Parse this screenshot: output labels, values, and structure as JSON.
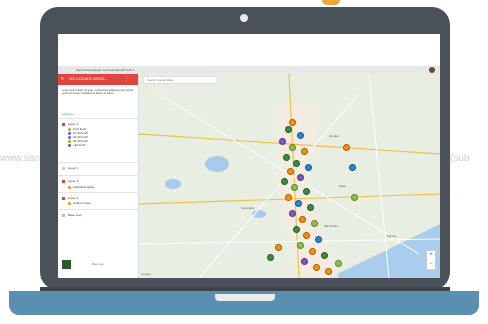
{
  "browser": {
    "url": "https://www.google.com/maps/d/edit?mid=1...",
    "map_search_placeholder": "Search Google Maps"
  },
  "sidebar": {
    "title": "VELOCIDADE MEDIA...",
    "description": "Lorem ipsum dolor sit amet, consectetur adipiscing elit, sed do eiusmod tempor incididunt ut labore et dolore",
    "link_label": "Add layer",
    "layers": [
      {
        "name": "Layer 1",
        "items": [
          {
            "label": "0-10 km/h",
            "color": "#8bc34a"
          },
          {
            "label": "10-20 km/h",
            "color": "#7e57c2"
          },
          {
            "label": "20-30 km/h",
            "color": "#1e88e5"
          },
          {
            "label": "30-40 km/h",
            "color": "#ff8f00"
          },
          {
            "label": "+40 km/h",
            "color": "#388e3c"
          }
        ]
      },
      {
        "name": "Layer 2",
        "items": []
      },
      {
        "name": "Layer 3",
        "items": [
          {
            "label": "Individual styles",
            "color": "#ff8f00"
          }
        ]
      },
      {
        "name": "Layer 4",
        "items": [
          {
            "label": "Uniform style",
            "color": "#ff8f00"
          }
        ]
      },
      {
        "name": "Base map",
        "items": []
      }
    ],
    "footer_text": "Base map"
  },
  "map": {
    "cities": [
      "Sorocaba",
      "Jundiaí",
      "São Paulo",
      "Santos",
      "Mogi"
    ],
    "footer": "Google"
  },
  "colors": {
    "header_red": "#e0443e",
    "laptop_body": "#4a5158",
    "laptop_base": "#5a8fb0"
  },
  "watermark": {
    "left": "www.san",
    "right": "(sub"
  }
}
